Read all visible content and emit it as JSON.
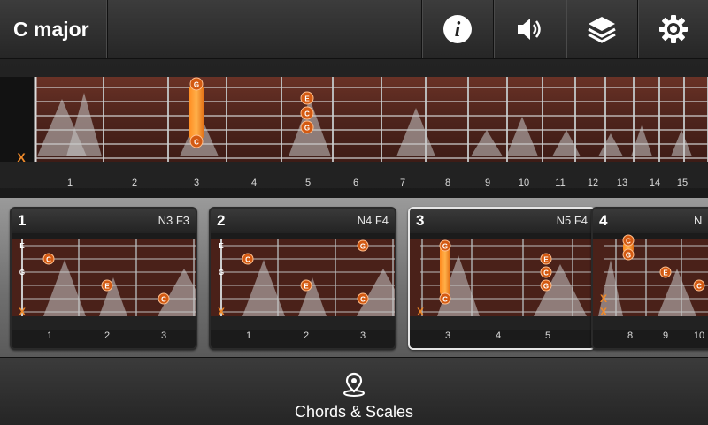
{
  "header": {
    "title": "C major",
    "buttons": [
      {
        "name": "info-button",
        "icon": "info-icon"
      },
      {
        "name": "sound-button",
        "icon": "speaker-icon"
      },
      {
        "name": "layers-button",
        "icon": "layers-icon"
      },
      {
        "name": "settings-button",
        "icon": "gear-icon"
      }
    ]
  },
  "neck": {
    "fret_numbers": [
      "1",
      "2",
      "3",
      "4",
      "5",
      "6",
      "7",
      "8",
      "9",
      "10",
      "11",
      "12",
      "13",
      "14",
      "15"
    ],
    "muted_marker": "X",
    "notes": [
      "G",
      "C",
      "E",
      "C",
      "G"
    ]
  },
  "voicings": [
    {
      "number": "1",
      "fingering": "N3 F3",
      "frets": [
        "1",
        "2",
        "3"
      ],
      "string_labels": [
        "E",
        "G"
      ],
      "notes": [
        "C",
        "E",
        "C"
      ],
      "mute": "X"
    },
    {
      "number": "2",
      "fingering": "N4 F4",
      "frets": [
        "1",
        "2",
        "3"
      ],
      "string_labels": [
        "E",
        "G"
      ],
      "notes": [
        "G",
        "C",
        "E",
        "C"
      ],
      "mute": "X"
    },
    {
      "number": "3",
      "fingering": "N5 F4",
      "frets": [
        "3",
        "4",
        "5"
      ],
      "notes": [
        "G",
        "C",
        "E",
        "C",
        "G"
      ],
      "mute": "X",
      "selected": true
    },
    {
      "number": "4",
      "fingering": "N",
      "frets": [
        "8",
        "9",
        "10"
      ],
      "notes": [
        "C",
        "G",
        "E",
        "C"
      ],
      "mute": "X"
    }
  ],
  "bottom_nav": {
    "label": "Chords & Scales",
    "icon": "map-pin-icon"
  },
  "colors": {
    "note_orange": "#d35a12",
    "accent_orange": "#f08a2a",
    "wood": "#5a2a20",
    "selected_border": "#e6e6e6"
  }
}
